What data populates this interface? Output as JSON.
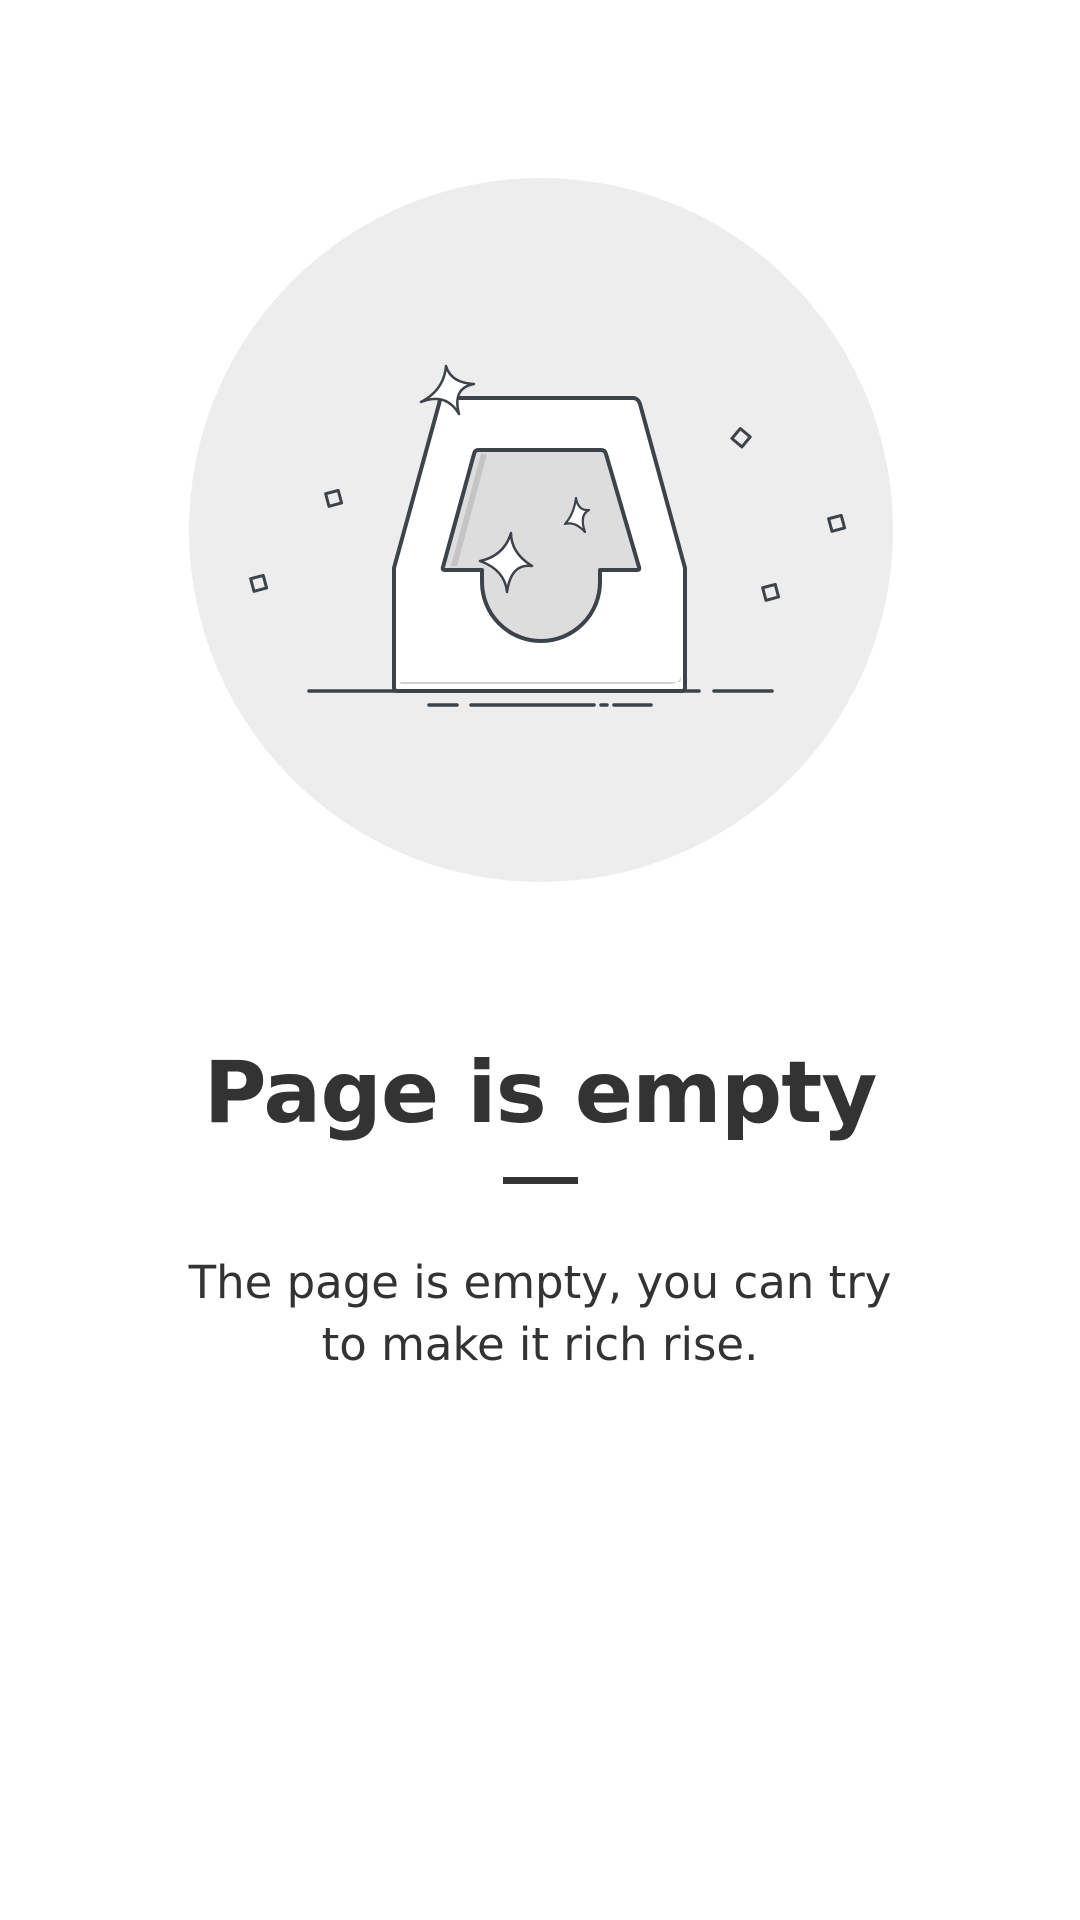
{
  "empty_state": {
    "illustration_icon": "empty-inbox-tray-icon",
    "title": "Page is empty",
    "description": "The page is empty, you can try to make it rich rise."
  },
  "colors": {
    "background": "#ffffff",
    "circle": "#ededed",
    "stroke": "#3c434a",
    "tray_fill": "#ffffff",
    "slot_fill": "#dddddd",
    "text": "#333333"
  }
}
